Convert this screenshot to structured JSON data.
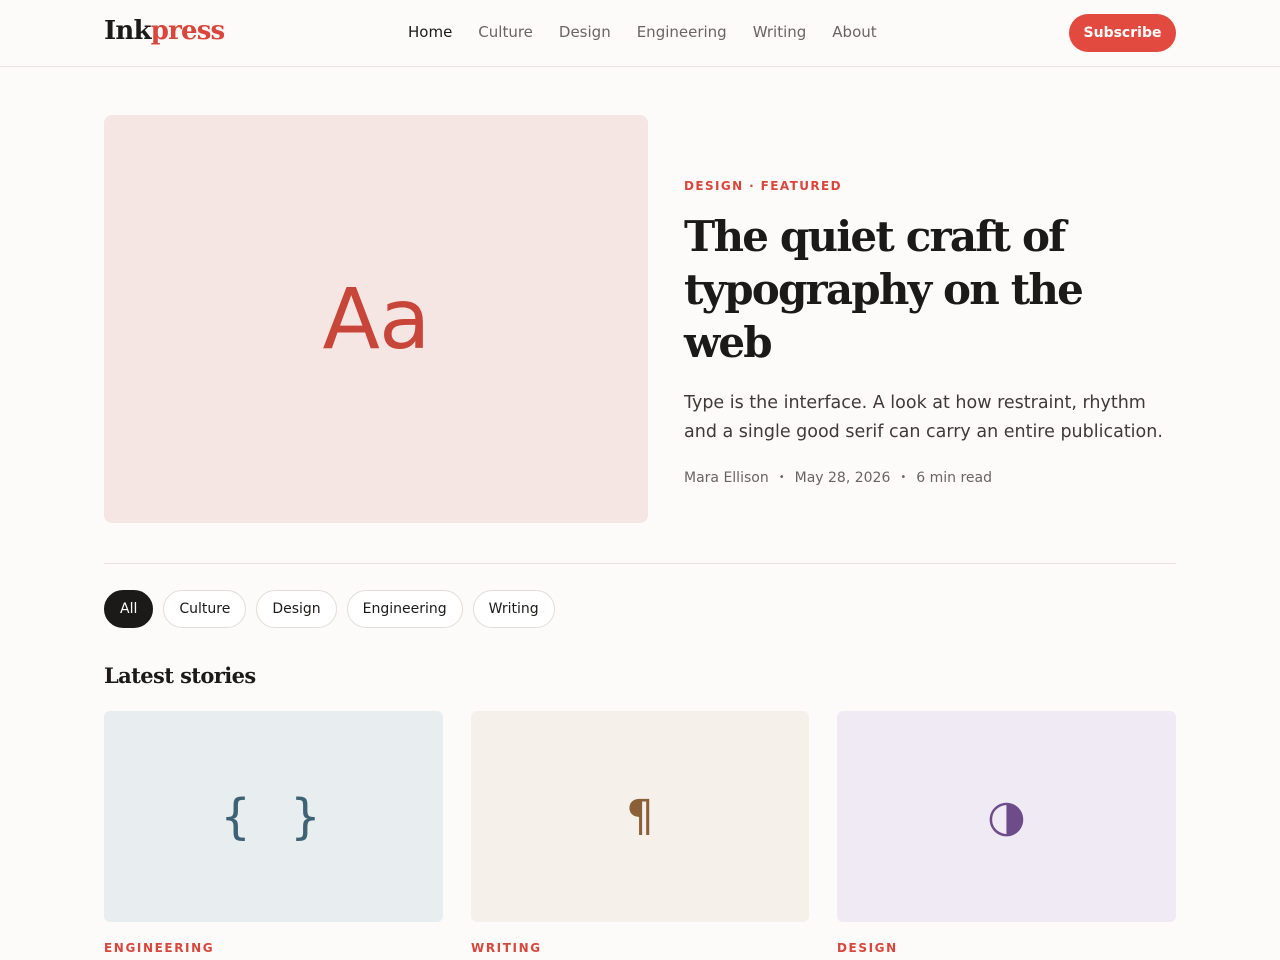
{
  "header": {
    "logo_part1": "Ink",
    "logo_part2": "press",
    "nav": [
      {
        "label": "Home"
      },
      {
        "label": "Culture"
      },
      {
        "label": "Design"
      },
      {
        "label": "Engineering"
      },
      {
        "label": "Writing"
      },
      {
        "label": "About"
      }
    ],
    "active_nav": "Home",
    "subscribe_label": "Subscribe"
  },
  "featured": {
    "image_glyph": "Aa",
    "kicker": "DESIGN · FEATURED",
    "title": "The quiet craft of typography on the web",
    "summary": "Type is the interface. A look at how restraint, rhythm and a single good serif can carry an entire publication.",
    "author": "Mara Ellison",
    "date": "May 28, 2026",
    "read_time": "6 min read",
    "meta_separator": "•"
  },
  "filters": {
    "chips": [
      {
        "label": "All"
      },
      {
        "label": "Culture"
      },
      {
        "label": "Design"
      },
      {
        "label": "Engineering"
      },
      {
        "label": "Writing"
      }
    ],
    "active": "All"
  },
  "latest": {
    "title": "Latest stories",
    "cards": [
      {
        "glyph": "{ }",
        "category": "ENGINEERING",
        "icon": "code-braces-icon"
      },
      {
        "glyph": "¶",
        "category": "WRITING",
        "icon": "pilcrow-icon"
      },
      {
        "glyph": "◑",
        "category": "DESIGN",
        "icon": "half-circle-icon"
      }
    ]
  },
  "colors": {
    "accent": "#e34a3f",
    "text": "#1c1a18",
    "background": "#fcfbfa"
  }
}
